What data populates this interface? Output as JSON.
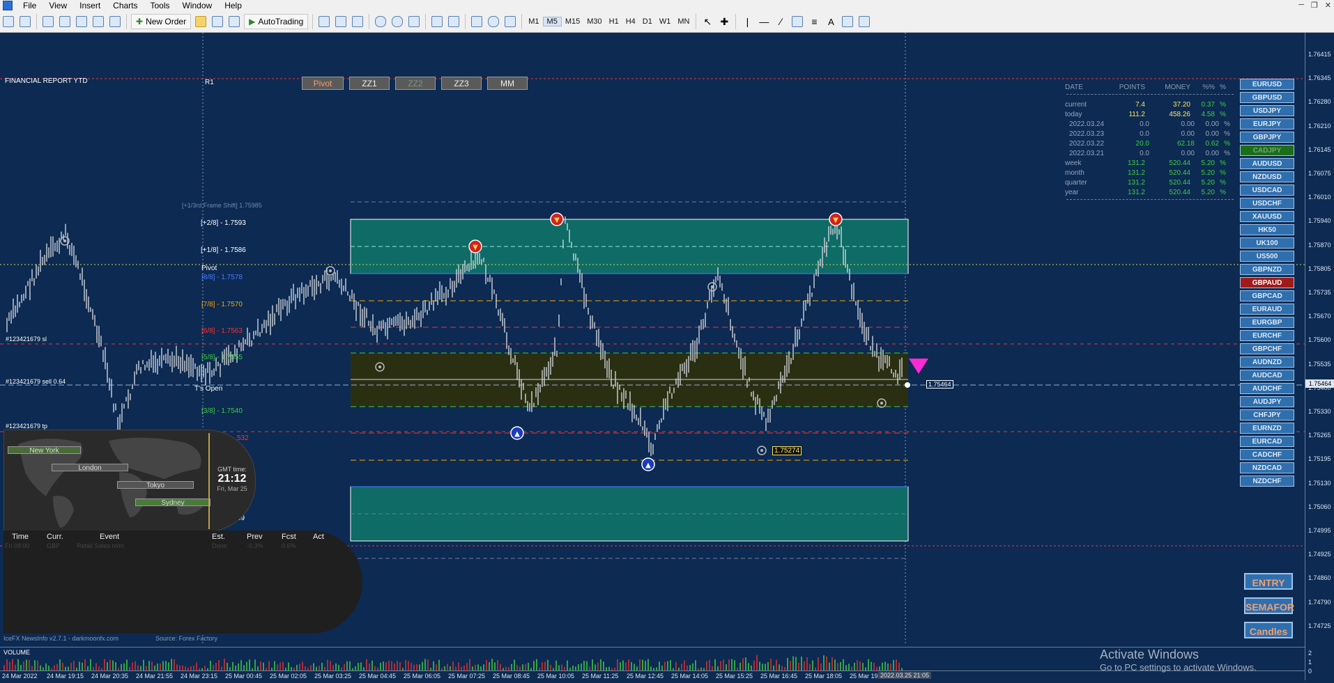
{
  "menu": {
    "items": [
      "File",
      "View",
      "Insert",
      "Charts",
      "Tools",
      "Window",
      "Help"
    ]
  },
  "toolbar": {
    "new_order": "New Order",
    "autotrading": "AutoTrading",
    "timeframes": [
      "M1",
      "M5",
      "M15",
      "M30",
      "H1",
      "H4",
      "D1",
      "W1",
      "MN"
    ],
    "active_timeframe": "M5"
  },
  "chart": {
    "title": "FINANCIAL REPORT YTD",
    "top_buttons": [
      "Pivot",
      "ZZ1",
      "ZZ2",
      "ZZ3",
      "MM"
    ],
    "levels": {
      "frame_shift": "[+1/3rd Frame Shift]  1.75985",
      "r1": "R1",
      "p28": "[+2/8] - 1.7593",
      "p18": "[+1/8] - 1.7586",
      "pivot": "Pivot",
      "l88": "[8/8] - 1.7578",
      "l78": "[7/8] - 1.7570",
      "l68": "[6/8] - 1.7563",
      "l58": "[5/8] - 1.7555",
      "l38": "[3/8] - 1.7540",
      "sl": "#123421679 sl",
      "sell": "#123421679 sell 0.64",
      "tp": "#123421679 tp",
      "topen": "T's Open",
      "s1": "S1",
      "fragment_532": "532",
      "fragment_09": "09"
    },
    "low_label": "1.75274",
    "current_label": "1.75464"
  },
  "report": {
    "header": [
      "DATE",
      "POINTS",
      "MONEY",
      "%%",
      "%"
    ],
    "rows": [
      {
        "date": "current",
        "points": "7.4",
        "money": "37.20",
        "pct": "0.37",
        "sign": "%"
      },
      {
        "date": "today",
        "points": "111.2",
        "money": "458.26",
        "pct": "4.58",
        "sign": "%"
      },
      {
        "date": "2022.03.24",
        "points": "0.0",
        "money": "0.00",
        "pct": "0.00",
        "sign": "%"
      },
      {
        "date": "2022.03.23",
        "points": "0.0",
        "money": "0.00",
        "pct": "0.00",
        "sign": "%"
      },
      {
        "date": "2022.03.22",
        "points": "20.0",
        "money": "62.18",
        "pct": "0.62",
        "sign": "%"
      },
      {
        "date": "2022.03.21",
        "points": "0.0",
        "money": "0.00",
        "pct": "0.00",
        "sign": "%"
      },
      {
        "date": "week",
        "points": "131.2",
        "money": "520.44",
        "pct": "5.20",
        "sign": "%"
      },
      {
        "date": "month",
        "points": "131.2",
        "money": "520.44",
        "pct": "5.20",
        "sign": "%"
      },
      {
        "date": "quarter",
        "points": "131.2",
        "money": "520.44",
        "pct": "5.20",
        "sign": "%"
      },
      {
        "date": "year",
        "points": "131.2",
        "money": "520.44",
        "pct": "5.20",
        "sign": "%"
      }
    ]
  },
  "symbols": [
    "EURUSD",
    "GBPUSD",
    "USDJPY",
    "EURJPY",
    "GBPJPY",
    "CADJPY",
    "AUDUSD",
    "NZDUSD",
    "USDCAD",
    "USDCHF",
    "XAUUSD",
    "HK50",
    "UK100",
    "US500",
    "GBPNZD",
    "GBPAUD",
    "GBPCAD",
    "EURAUD",
    "EURGBP",
    "EURCHF",
    "GBPCHF",
    "AUDNZD",
    "AUDCAD",
    "AUDCHF",
    "AUDJPY",
    "CHFJPY",
    "EURNZD",
    "EURCAD",
    "CADCHF",
    "NZDCAD",
    "NZDCHF"
  ],
  "active_symbol": "GBPAUD",
  "side_buttons": [
    "ENTRY",
    "SEMAFOR",
    "Candles"
  ],
  "sessions": [
    "New York",
    "London",
    "Tokyo",
    "Sydney"
  ],
  "gmt": {
    "label": "GMT time:",
    "time": "21:12",
    "date": "Fri, Mar 25"
  },
  "news": {
    "headers": [
      "Time",
      "Curr.",
      "Event",
      "Est.",
      "Prev",
      "Fcst",
      "Act"
    ],
    "row": [
      "Fri 08:00",
      "GBP",
      "Retail Sales m/m",
      "Done",
      "-0.3%",
      "0.6%"
    ]
  },
  "footer": {
    "left": "IceFX NewsInfo v2.7.1 - darkmoonfx.com",
    "source": "Source: Forex Factory"
  },
  "volume_label": "VOLUME",
  "y_ticks": [
    "1.76415",
    "1.76345",
    "1.76280",
    "1.76210",
    "1.76145",
    "1.76075",
    "1.76010",
    "1.75940",
    "1.75870",
    "1.75805",
    "1.75735",
    "1.75670",
    "1.75600",
    "1.75535",
    "1.75400",
    "1.75330",
    "1.75265",
    "1.75195",
    "1.75130",
    "1.75060",
    "1.74995",
    "1.74925",
    "1.74860",
    "1.74790",
    "1.74725"
  ],
  "y_current": "1.75464",
  "vol_ticks": [
    "2",
    "1",
    "0"
  ],
  "x_ticks": [
    "24 Mar 2022",
    "24 Mar 19:15",
    "24 Mar 20:35",
    "24 Mar 21:55",
    "24 Mar 23:15",
    "25 Mar 00:45",
    "25 Mar 02:05",
    "25 Mar 03:25",
    "25 Mar 04:45",
    "25 Mar 06:05",
    "25 Mar 07:25",
    "25 Mar 08:45",
    "25 Mar 10:05",
    "25 Mar 11:25",
    "25 Mar 12:45",
    "25 Mar 14:05",
    "25 Mar 15:25",
    "25 Mar 16:45",
    "25 Mar 18:05",
    "25 Mar 19:"
  ],
  "x_current": "2022.03.25 21:05",
  "watermark": {
    "line1": "Activate Windows",
    "line2": "Go to PC settings to activate Windows."
  }
}
